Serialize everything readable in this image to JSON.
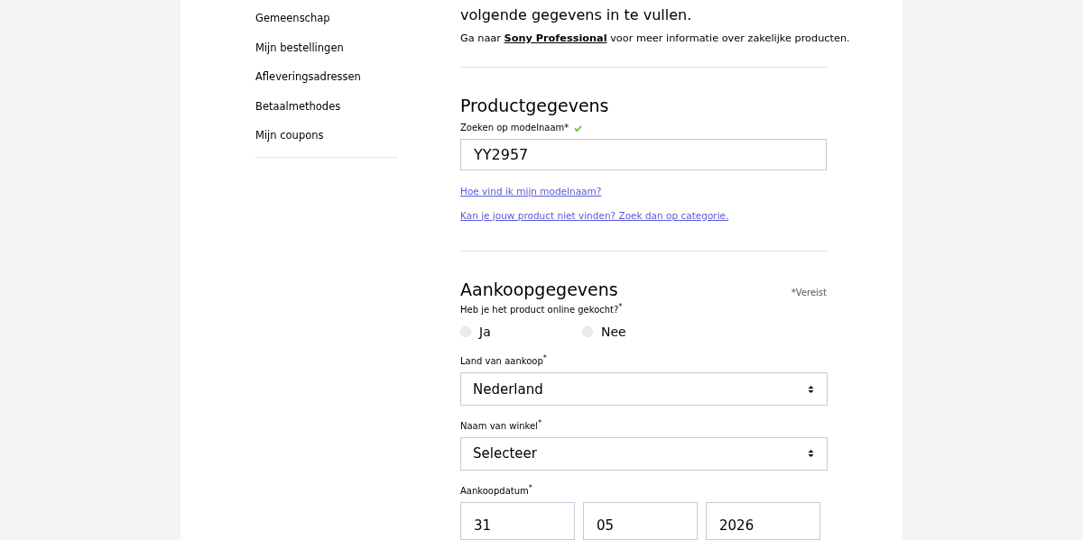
{
  "sidebar": {
    "items": [
      {
        "label": "Gemeenschap"
      },
      {
        "label": "Mijn bestellingen"
      },
      {
        "label": "Afleveringsadressen"
      },
      {
        "label": "Betaalmethodes"
      },
      {
        "label": "Mijn coupons"
      }
    ]
  },
  "intro": {
    "text": "volgende gegevens in te vullen.",
    "note_before": "Ga naar",
    "note_link": "Sony Professional",
    "note_after": "voor meer informatie over zakelijke producten."
  },
  "product": {
    "heading": "Productgegevens",
    "label": "Zoeken op modelnaam*",
    "valid": true,
    "value": "YY2957",
    "links": [
      "Hoe vind ik mijn modelnaam?",
      "Kan je jouw product niet vinden? Zoek dan op categorie."
    ]
  },
  "purchase": {
    "heading": "Aankoopgegevens",
    "required_note": "*Vereist",
    "online_label": "Heb je het product online gekocht?$^{*}$",
    "online_options": [
      {
        "label": "Ja",
        "selected": false
      },
      {
        "label": "Nee",
        "selected": false
      }
    ],
    "country_label": "Land van aankoop$^{*}$",
    "country_value": "Nederland",
    "store_label": "Naam van winkel$^{*}$",
    "store_value": "Selecteer",
    "date_label": "Aankoopdatum$^{*}$",
    "date_parts": [
      "31",
      "05",
      "2026"
    ]
  }
}
